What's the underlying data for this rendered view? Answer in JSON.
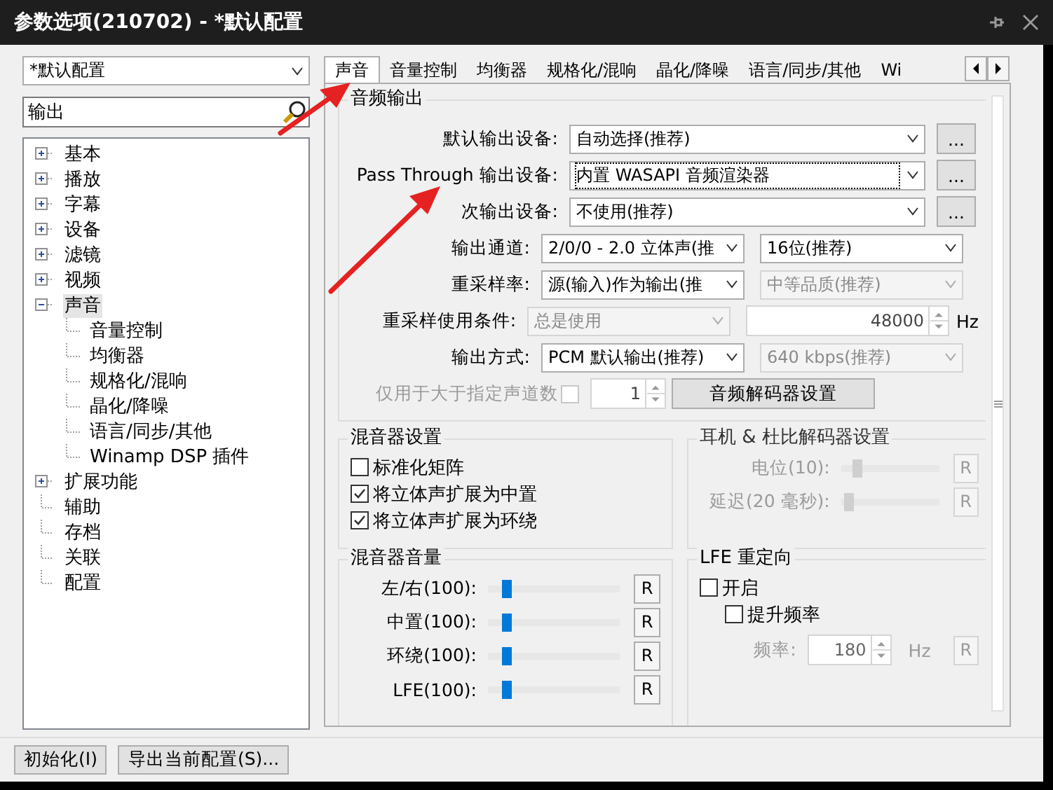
{
  "window": {
    "title": "参数选项(210702) - *默认配置"
  },
  "profile": {
    "value": "*默认配置"
  },
  "search": {
    "value": "输出"
  },
  "tree": [
    {
      "label": "基本",
      "expanded": false,
      "selected": false
    },
    {
      "label": "播放",
      "expanded": false,
      "selected": false
    },
    {
      "label": "字幕",
      "expanded": false,
      "selected": false
    },
    {
      "label": "设备",
      "expanded": false,
      "selected": false
    },
    {
      "label": "滤镜",
      "expanded": false,
      "selected": false
    },
    {
      "label": "视频",
      "expanded": false,
      "selected": false
    },
    {
      "label": "声音",
      "expanded": true,
      "selected": true,
      "children": [
        {
          "label": "音量控制",
          "selected": false
        },
        {
          "label": "均衡器",
          "selected": false
        },
        {
          "label": "规格化/混响",
          "selected": false
        },
        {
          "label": "晶化/降噪",
          "selected": false
        },
        {
          "label": "语言/同步/其他",
          "selected": false
        },
        {
          "label": "Winamp DSP 插件",
          "selected": false
        }
      ]
    },
    {
      "label": "扩展功能",
      "expanded": false,
      "selected": false
    },
    {
      "label": "辅助",
      "selected": false
    },
    {
      "label": "存档",
      "selected": false
    },
    {
      "label": "关联",
      "selected": false
    },
    {
      "label": "配置",
      "selected": false
    }
  ],
  "tabs": [
    {
      "label": "声音",
      "selected": true
    },
    {
      "label": "音量控制",
      "selected": false
    },
    {
      "label": "均衡器",
      "selected": false
    },
    {
      "label": "规格化/混响",
      "selected": false
    },
    {
      "label": "晶化/降噪",
      "selected": false
    },
    {
      "label": "语言/同步/其他",
      "selected": false
    },
    {
      "label": "Wi",
      "selected": false
    }
  ],
  "audio_output": {
    "title": "音频输出",
    "rows": [
      {
        "label": "默认输出设备:",
        "disabled": false,
        "controls": [
          {
            "kind": "select",
            "value": "自动选择(推荐)",
            "disabled": false
          },
          {
            "kind": "button",
            "value": "..."
          }
        ]
      },
      {
        "label": "Pass Through 输出设备:",
        "disabled": false,
        "controls": [
          {
            "kind": "select",
            "value": "内置 WASAPI 音频渲染器",
            "disabled": false,
            "focused": true
          },
          {
            "kind": "button",
            "value": "..."
          }
        ]
      },
      {
        "label": "次输出设备:",
        "disabled": false,
        "controls": [
          {
            "kind": "select",
            "value": "不使用(推荐)",
            "disabled": false
          },
          {
            "kind": "button",
            "value": "..."
          }
        ]
      },
      {
        "label": "输出通道:",
        "disabled": false,
        "controls": [
          {
            "kind": "select",
            "value": "2/0/0 - 2.0 立体声(推",
            "disabled": false
          },
          {
            "kind": "select",
            "value": "16位(推荐)",
            "disabled": false
          }
        ]
      },
      {
        "label": "重采样率:",
        "disabled": false,
        "controls": [
          {
            "kind": "select",
            "value": "源(输入)作为输出(推",
            "disabled": false
          },
          {
            "kind": "select",
            "value": "中等品质(推荐)",
            "disabled": true
          }
        ]
      },
      {
        "label": "重采样使用条件:",
        "disabled": false,
        "controls": [
          {
            "kind": "select",
            "value": "总是使用",
            "disabled": true
          },
          {
            "kind": "spin",
            "value": "48000"
          },
          {
            "kind": "unit",
            "value": "Hz",
            "disabled": false
          }
        ]
      },
      {
        "label": "输出方式:",
        "disabled": false,
        "controls": [
          {
            "kind": "select",
            "value": "PCM 默认输出(推荐)",
            "disabled": false
          },
          {
            "kind": "select",
            "value": "640 kbps(推荐)",
            "disabled": true
          }
        ]
      },
      {
        "label": "仅用于大于指定声道数",
        "disabled": true,
        "controls": [
          {
            "kind": "checkbox",
            "checked": false,
            "disabled": true
          },
          {
            "kind": "spin",
            "value": "1"
          },
          {
            "kind": "button",
            "value": "音频解码器设置"
          }
        ]
      }
    ]
  },
  "mixer_settings": {
    "title": "混音器设置",
    "options": [
      {
        "label": "标准化矩阵",
        "checked": false
      },
      {
        "label": "将立体声扩展为中置",
        "checked": true
      },
      {
        "label": "将立体声扩展为环绕",
        "checked": true
      }
    ]
  },
  "headphone": {
    "title": "耳机 & 杜比解码器设置",
    "disabled": true,
    "sliders": [
      {
        "label": "电位(10):",
        "level": 0.13,
        "reset": "R"
      },
      {
        "label": "延迟(20 毫秒):",
        "level": 0.03,
        "reset": "R"
      }
    ]
  },
  "mixer_volume": {
    "title": "混音器音量",
    "sliders": [
      {
        "label": "左/右(100):",
        "level": 0.12,
        "reset": "R"
      },
      {
        "label": "中置(100):",
        "level": 0.12,
        "reset": "R"
      },
      {
        "label": "环绕(100):",
        "level": 0.12,
        "reset": "R"
      },
      {
        "label": "LFE(100):",
        "level": 0.12,
        "reset": "R"
      }
    ]
  },
  "lfe": {
    "title": "LFE 重定向",
    "enable": {
      "label": "开启",
      "checked": false
    },
    "boost": {
      "label": "提升频率",
      "checked": false
    },
    "frequency": {
      "label": "频率:",
      "value": "180",
      "unit": "Hz",
      "reset": "R",
      "disabled": true
    }
  },
  "footer": {
    "buttons": [
      "初始化(I)",
      "导出当前配置(S)..."
    ]
  }
}
